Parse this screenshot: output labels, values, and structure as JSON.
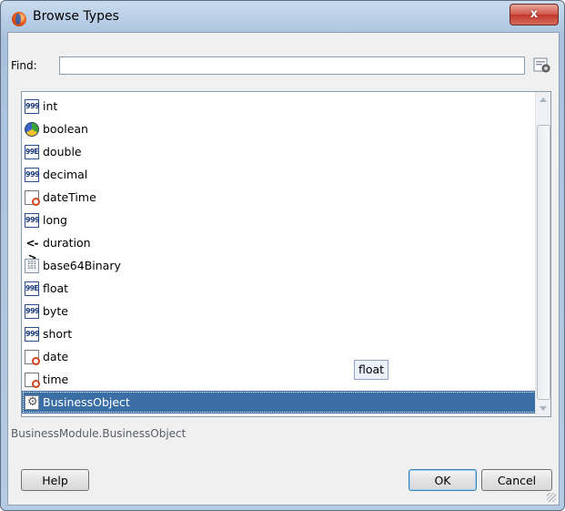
{
  "window": {
    "title": "Browse Types",
    "close_label": "x",
    "app_icon": "oracle-orb-icon"
  },
  "find": {
    "label": "Find:",
    "value": "",
    "placeholder": "",
    "options_icon": "gear-icon"
  },
  "types": {
    "items": [
      {
        "label": "int",
        "icon": "numeric-999-icon"
      },
      {
        "label": "boolean",
        "icon": "boolean-orb-icon"
      },
      {
        "label": "double",
        "icon": "numeric-99e-icon"
      },
      {
        "label": "decimal",
        "icon": "numeric-999-icon"
      },
      {
        "label": "dateTime",
        "icon": "calendar-clock-icon"
      },
      {
        "label": "long",
        "icon": "numeric-999-icon"
      },
      {
        "label": "duration",
        "icon": "double-arrow-icon"
      },
      {
        "label": "base64Binary",
        "icon": "binary-file-icon"
      },
      {
        "label": "float",
        "icon": "numeric-99e-icon"
      },
      {
        "label": "byte",
        "icon": "numeric-999-icon"
      },
      {
        "label": "short",
        "icon": "numeric-999-icon"
      },
      {
        "label": "date",
        "icon": "calendar-clock-icon"
      },
      {
        "label": "time",
        "icon": "calendar-clock-icon"
      },
      {
        "label": "BusinessObject",
        "icon": "business-object-icon",
        "selected": true
      }
    ],
    "icon_text": {
      "n999": "999",
      "n99e": "99E",
      "dur": "<->",
      "bin": "101 101"
    },
    "tooltip": "float"
  },
  "selection_path": "BusinessModule.BusinessObject",
  "buttons": {
    "help": "Help",
    "ok": "OK",
    "cancel": "Cancel"
  },
  "colors": {
    "selection": "#3a6ea5",
    "close_button": "#c2382b"
  }
}
